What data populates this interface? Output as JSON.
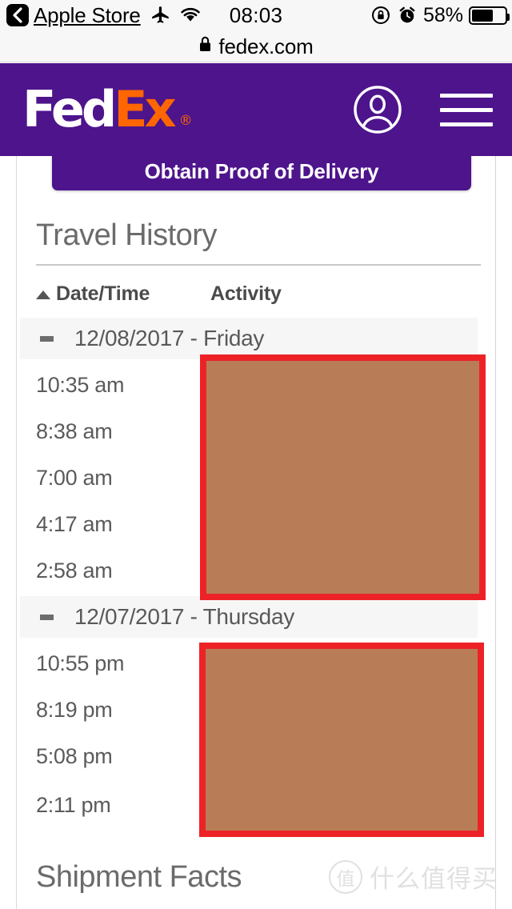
{
  "status_bar": {
    "back_app_label": "Apple Store",
    "back_icon": "chevron-left-icon",
    "airplane_icon": "airplane-mode-icon",
    "wifi_icon": "wifi-icon",
    "time": "08:03",
    "rotation_lock_icon": "rotation-lock-icon",
    "alarm_icon": "alarm-clock-icon",
    "battery_percent": "58%",
    "battery_level": 58
  },
  "browser": {
    "lock_icon": "lock-icon",
    "url": "fedex.com"
  },
  "header": {
    "logo_fed": "Fed",
    "logo_ex": "Ex",
    "logo_registered": "®",
    "account_icon": "account-person-icon",
    "menu_icon": "hamburger-menu-icon",
    "background_color": "#4D148C",
    "accent_color": "#FF6600"
  },
  "page": {
    "proof_of_delivery_button": "Obtain Proof of Delivery",
    "travel_history_title": "Travel History",
    "shipment_facts_title": "Shipment Facts",
    "table": {
      "columns": [
        "Date/Time",
        "Activity"
      ],
      "sort_indicator": "ascending",
      "groups": [
        {
          "date_label": "12/08/2017 - Friday",
          "expanded": true,
          "collapse_icon": "minus-icon",
          "rows": [
            {
              "time": "10:35 am",
              "activity": ""
            },
            {
              "time": "8:38 am",
              "activity": ""
            },
            {
              "time": "7:00 am",
              "activity": ""
            },
            {
              "time": "4:17 am",
              "activity": ""
            },
            {
              "time": "2:58 am",
              "activity": ""
            }
          ]
        },
        {
          "date_label": "12/07/2017 - Thursday",
          "expanded": true,
          "collapse_icon": "minus-icon",
          "rows": [
            {
              "time": "10:55 pm",
              "activity": ""
            },
            {
              "time": "8:19 pm",
              "activity": ""
            },
            {
              "time": "5:08 pm",
              "activity": ""
            },
            {
              "time": "2:11 pm",
              "activity": ""
            }
          ]
        }
      ]
    },
    "redactions": [
      {
        "label": "activity-redaction-friday",
        "fill": "#B87D57",
        "border": "#EC2227"
      },
      {
        "label": "activity-redaction-thursday",
        "fill": "#B87D57",
        "border": "#EC2227"
      }
    ]
  },
  "watermark": {
    "badge": "值",
    "text": "什么值得买"
  }
}
